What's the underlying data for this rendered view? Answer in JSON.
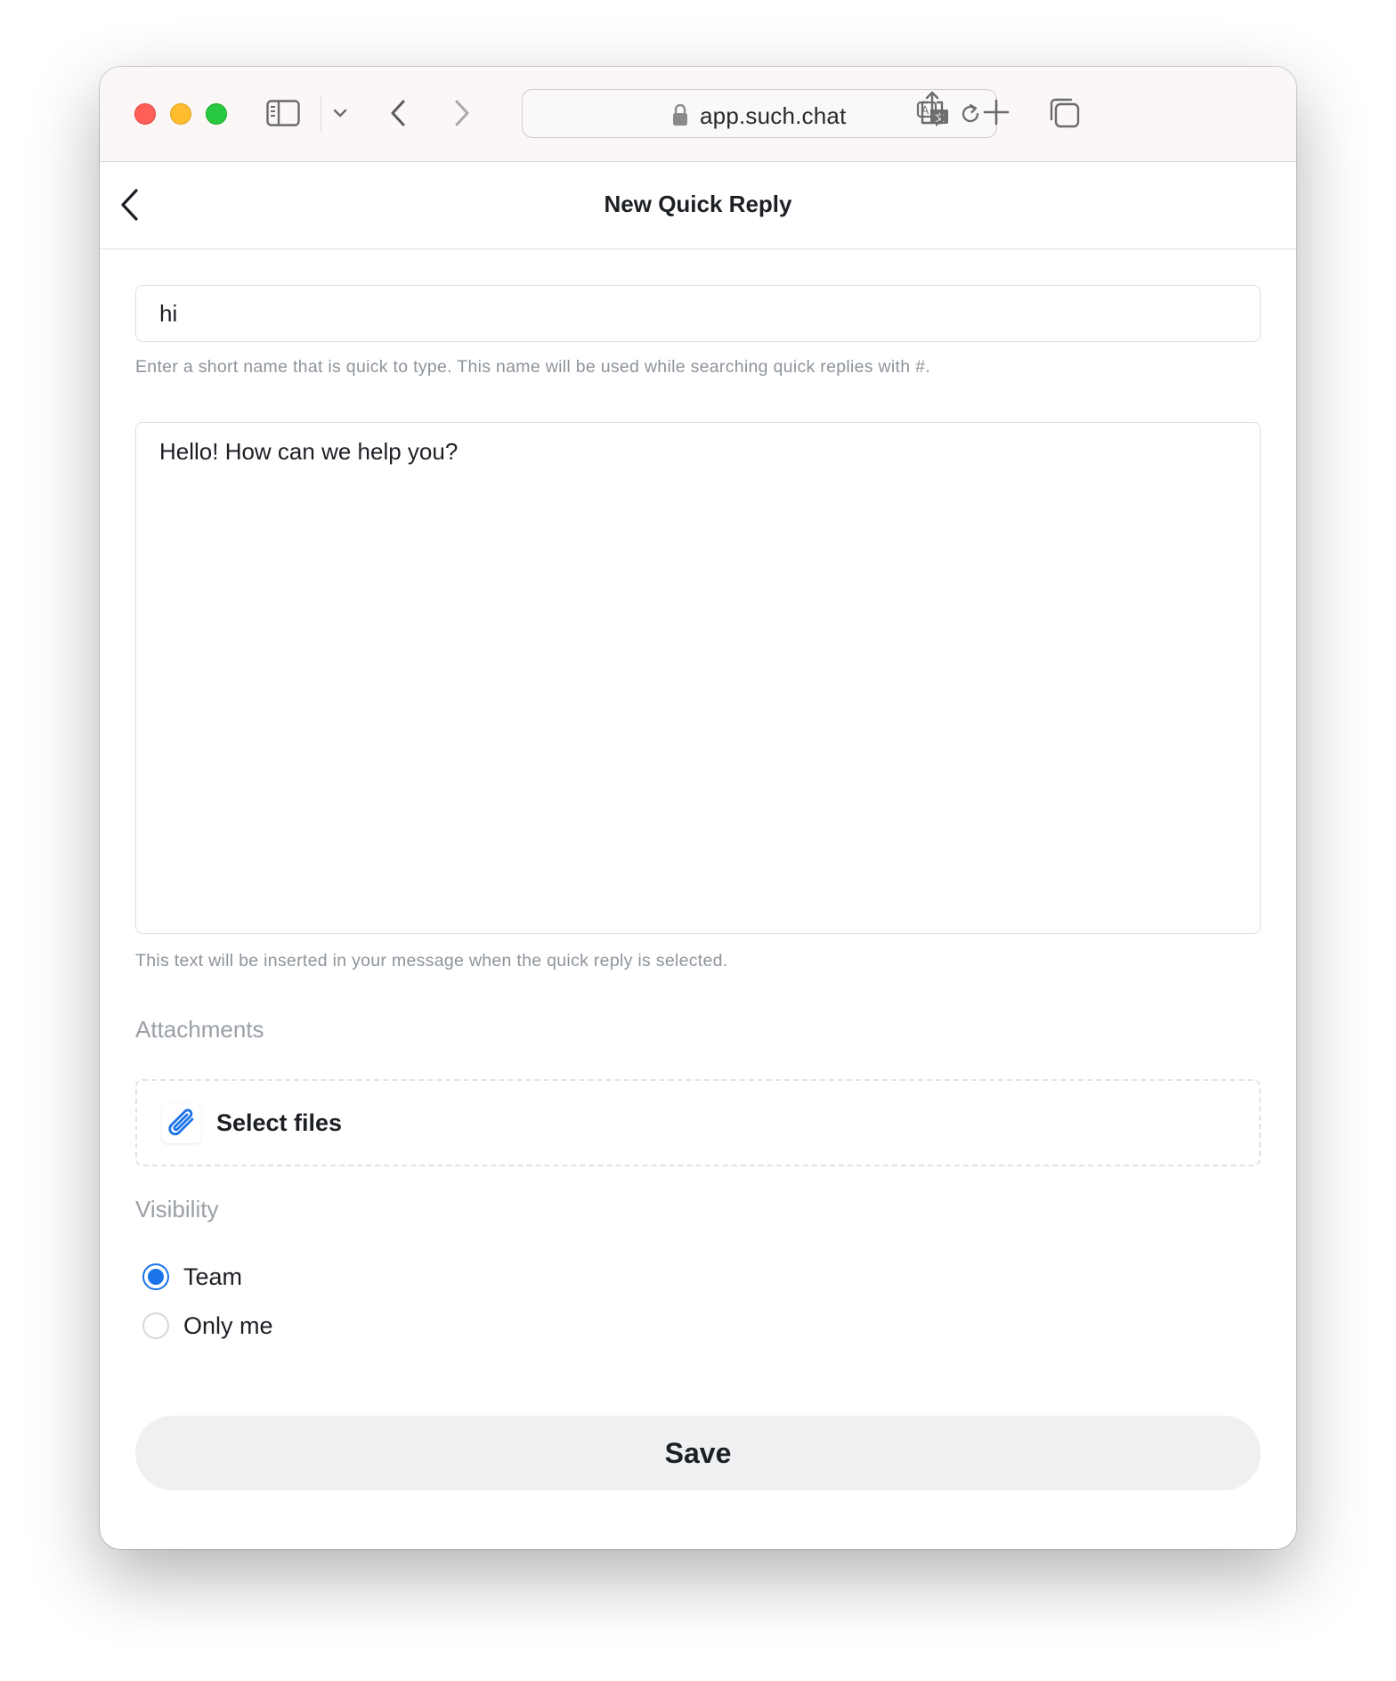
{
  "browser": {
    "url": "app.such.chat",
    "icons": [
      "sidebar-icon",
      "chevron-down-icon",
      "back-icon",
      "forward-icon",
      "lock-icon",
      "translate-icon",
      "reload-icon",
      "share-icon",
      "new-tab-icon",
      "tabs-overview-icon"
    ]
  },
  "header": {
    "title": "New Quick Reply",
    "back_icon": "chevron-left-icon"
  },
  "form": {
    "name": {
      "value": "hi",
      "help": "Enter a short name that is quick to type. This name will be used while searching quick replies with #."
    },
    "text": {
      "value": "Hello! How can we help you?",
      "help": "This text will be inserted in your message when the quick reply is selected."
    },
    "attachments": {
      "label": "Attachments",
      "button_label": "Select files",
      "icon": "paperclip-icon"
    },
    "visibility": {
      "label": "Visibility",
      "options": [
        {
          "label": "Team",
          "selected": true
        },
        {
          "label": "Only me",
          "selected": false
        }
      ]
    },
    "save_label": "Save"
  },
  "colors": {
    "accent": "#1a73e8",
    "save_bg": "#eff0f2",
    "help_text": "#8d949c"
  }
}
